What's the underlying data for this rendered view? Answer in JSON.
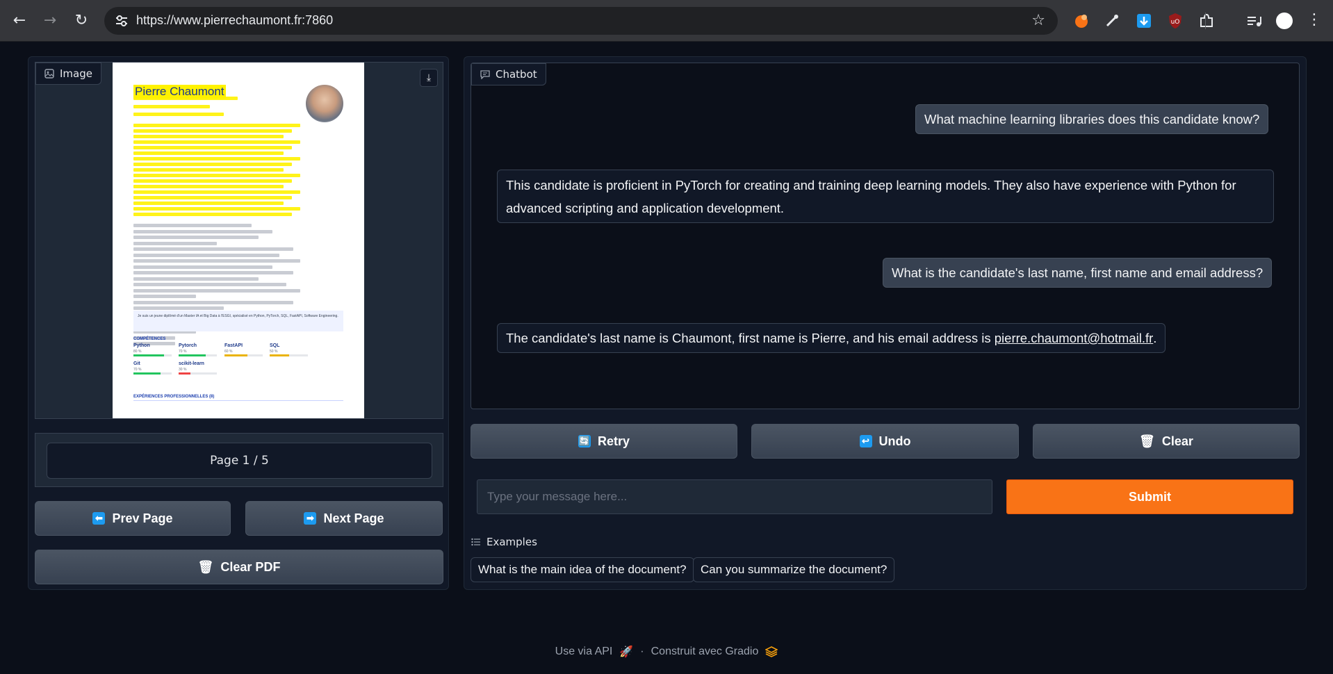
{
  "browser": {
    "url": "https://www.pierrechaumont.fr:7860",
    "back_icon": "arrow-left-icon",
    "forward_icon": "arrow-right-icon",
    "reload_icon": "reload-icon"
  },
  "left": {
    "image_label": "Image",
    "document": {
      "name": "Pierre Chaumont",
      "summary_text": "Je suis un jeune diplômé d'un Master IA et Big Data à l'ESGI, spécialisé en Python, PyTorch, SQL, FastAPI, Software Engineering.",
      "section_competences": "COMPÉTENCES",
      "section_experiences": "EXPÉRIENCES PROFESSIONNELLES (8)",
      "skills": [
        {
          "name": "Python",
          "level": "80 %"
        },
        {
          "name": "Pytorch",
          "level": "70 %"
        },
        {
          "name": "FastAPI",
          "level": "60 %"
        },
        {
          "name": "SQL",
          "level": "50 %"
        },
        {
          "name": "Git",
          "level": "70 %"
        },
        {
          "name": "scikit-learn",
          "level": "30 %"
        }
      ]
    },
    "page_indicator": "Page 1 / 5",
    "prev_label": "Prev Page",
    "next_label": "Next Page",
    "clear_pdf_label": "Clear PDF"
  },
  "chat": {
    "label": "Chatbot",
    "messages": [
      {
        "role": "user",
        "text": "What machine learning libraries does this candidate know?"
      },
      {
        "role": "bot",
        "text": "This candidate is proficient in PyTorch for creating and training deep learning models. They also have experience with Python for",
        "text2": "advanced scripting and application development."
      },
      {
        "role": "user",
        "text": "What is the candidate's last name, first name and email address?"
      },
      {
        "role": "bot",
        "text": "The candidate's last name is Chaumont, first name is Pierre, and his email address is ",
        "link": "pierre.chaumont@hotmail.fr",
        "suffix": "."
      }
    ],
    "retry_label": "Retry",
    "undo_label": "Undo",
    "clear_label": "Clear",
    "input_placeholder": "Type your message here...",
    "submit_label": "Submit",
    "examples_label": "Examples",
    "examples": [
      "What is the main idea of the document?",
      "Can you summarize the document?"
    ]
  },
  "footer": {
    "api_label": "Use via API",
    "separator": "·",
    "built_label": "Construit avec Gradio"
  },
  "colors": {
    "accent": "#f97316",
    "background": "#0b0f19",
    "panel": "#111827",
    "highlight": "#fff200"
  }
}
